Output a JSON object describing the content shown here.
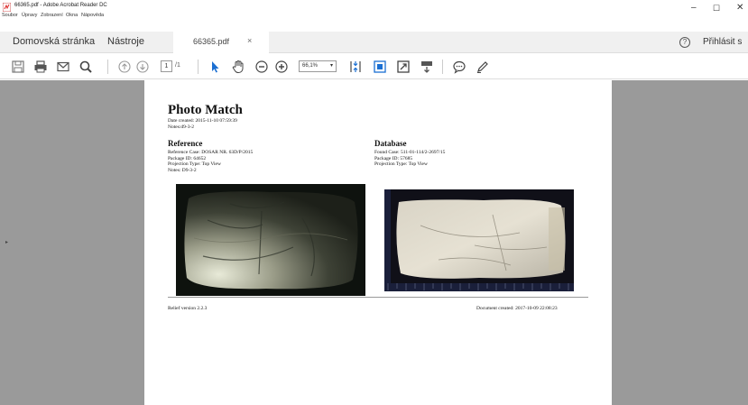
{
  "window": {
    "title": "66365.pdf - Adobe Acrobat Reader DC",
    "minimize_glyph": "–",
    "maximize_glyph": "☐",
    "close_glyph": "✕"
  },
  "menu": [
    "Soubor",
    "Úpravy",
    "Zobrazení",
    "Okna",
    "Nápověda"
  ],
  "tabs": {
    "home": "Domovská stránka",
    "tools": "Nástroje",
    "document": "66365.pdf",
    "close_glyph": "×"
  },
  "account": {
    "help_glyph": "?",
    "sign_in": "Přihlásit s"
  },
  "toolbar": {
    "page_current": "1",
    "page_total": "/1",
    "zoom": "66,1%",
    "zoom_arrow": "▾",
    "icons": [
      "save-icon",
      "print-icon",
      "email-icon",
      "search-icon",
      "page-up-icon",
      "page-down-icon",
      "select-cursor-icon",
      "hand-tool-icon",
      "zoom-out-icon",
      "zoom-in-icon",
      "fit-page-icon",
      "fit-width-icon",
      "fullscreen-icon",
      "scroll-mode-icon",
      "comment-icon",
      "highlight-pen-icon"
    ]
  },
  "viewport": {
    "scroll_handle": "▸"
  },
  "document": {
    "title": "Photo Match",
    "date_created": "Date created: 2015-11-10 07:59:39",
    "notes": "Notes:d9-3-2",
    "reference": {
      "heading": "Reference",
      "lines": [
        "Reference Case: DOSAR NR. 63D/P/2015",
        "Package ID: 64652",
        "Projection Type: Top View",
        "Notes: D9-3-2"
      ]
    },
    "database": {
      "heading": "Database",
      "lines": [
        "Found Case: 511-01-114/2-2697/15",
        "Package ID: 57685",
        "Projection Type: Top View"
      ]
    },
    "footer_left": "Relief version 2.2.3",
    "footer_right": "Document created: 2017-10-09 22:08:23"
  },
  "colors": {
    "accent_blue": "#1b6fd2",
    "viewport_gray": "#9a9a9a"
  }
}
